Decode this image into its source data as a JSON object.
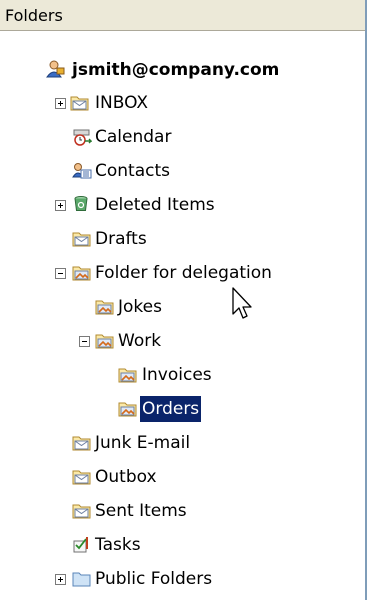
{
  "pane": {
    "title": "Folders"
  },
  "tree": {
    "account": "jsmith@company.com",
    "inbox": "INBOX",
    "calendar": "Calendar",
    "contacts": "Contacts",
    "deleted": "Deleted Items",
    "drafts": "Drafts",
    "delegation": "Folder for delegation",
    "jokes": "Jokes",
    "work": "Work",
    "invoices": "Invoices",
    "orders": "Orders",
    "junk": "Junk E-mail",
    "outbox": "Outbox",
    "sent": "Sent Items",
    "tasks": "Tasks",
    "public": "Public Folders"
  },
  "icons": {
    "account": "user-icon",
    "mail_folder": "mail-folder-icon",
    "calendar": "calendar-icon",
    "contacts": "contacts-icon",
    "deleted": "recycle-bin-icon",
    "shared_folder": "shared-folder-icon",
    "tasks": "tasks-icon",
    "public": "folder-icon"
  },
  "colors": {
    "selection": "#0a246a",
    "header_bg": "#ece9d8"
  }
}
